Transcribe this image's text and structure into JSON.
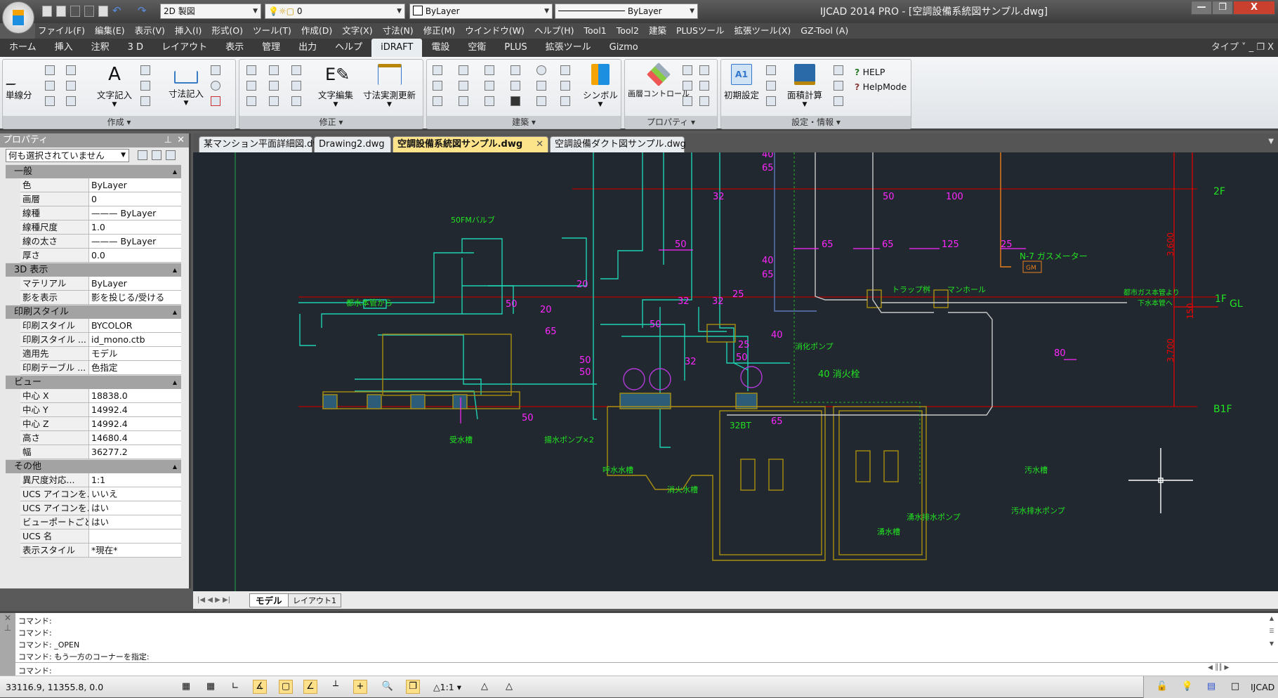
{
  "window": {
    "title": "IJCAD 2014 PRO - [空調設備系統図サンプル.dwg]",
    "minimize": "—",
    "restore": "❐",
    "close": "X"
  },
  "quick_access": {
    "workspace": "2D 製図",
    "layer": "0",
    "color": "ByLayer",
    "linetype": "ByLayer"
  },
  "menu": [
    "ファイル(F)",
    "編集(E)",
    "表示(V)",
    "挿入(I)",
    "形式(O)",
    "ツール(T)",
    "作成(D)",
    "文字(X)",
    "寸法(N)",
    "修正(M)",
    "ウインドウ(W)",
    "ヘルプ(H)",
    "Tool1",
    "Tool2",
    "建築",
    "PLUSツール",
    "拡張ツール(X)",
    "GZ-Tool (A)"
  ],
  "ribbon_tabs": [
    "ホーム",
    "挿入",
    "注釈",
    "3 D",
    "レイアウト",
    "表示",
    "管理",
    "出力",
    "ヘルプ",
    "iDRAFT",
    "電設",
    "空衛",
    "PLUS",
    "拡張ツール",
    "Gizmo"
  ],
  "ribbon_active_tab": "iDRAFT",
  "ribbon_right": "タイプ ˅  _  ❐  X",
  "ribbon_groups": {
    "create": {
      "title": "作成 ▾",
      "single_line": "単線分",
      "text": "文字記入",
      "dimension": "寸法記入"
    },
    "modify": {
      "title": "修正 ▾",
      "text_edit": "文字編集",
      "dim_update": "寸法実測更新"
    },
    "architecture": {
      "title": "建築 ▾",
      "symbol": "シンボル"
    },
    "properties": {
      "title": "プロパティ ▾",
      "layer_control": "画層コントロール"
    },
    "settings": {
      "title": "設定・情報 ▾",
      "initial": "初期設定",
      "area": "面積計算",
      "help": "HELP",
      "helpmode": "HelpMode"
    }
  },
  "properties_panel": {
    "title": "プロパティ",
    "selection": "何も選択されていません",
    "sections": [
      {
        "name": "一般",
        "rows": [
          [
            "色",
            "ByLayer"
          ],
          [
            "画層",
            "0"
          ],
          [
            "線種",
            "——— ByLayer"
          ],
          [
            "線種尺度",
            "1.0"
          ],
          [
            "線の太さ",
            "——— ByLayer"
          ],
          [
            "厚さ",
            "0.0"
          ]
        ]
      },
      {
        "name": "3D 表示",
        "rows": [
          [
            "マテリアル",
            "ByLayer"
          ],
          [
            "影を表示",
            "影を投じる/受ける"
          ]
        ]
      },
      {
        "name": "印刷スタイル",
        "rows": [
          [
            "印刷スタイル",
            "BYCOLOR"
          ],
          [
            "印刷スタイル ...",
            "id_mono.ctb"
          ],
          [
            "適用先",
            "モデル"
          ],
          [
            "印刷テーブル ...",
            "色指定"
          ]
        ]
      },
      {
        "name": "ビュー",
        "rows": [
          [
            "中心 X",
            "18838.0"
          ],
          [
            "中心 Y",
            "14992.4"
          ],
          [
            "中心 Z",
            "14992.4"
          ],
          [
            "高さ",
            "14680.4"
          ],
          [
            "幅",
            "36277.2"
          ]
        ]
      },
      {
        "name": "その他",
        "rows": [
          [
            "異尺度対応...",
            "1:1"
          ],
          [
            "UCS アイコンを...",
            "いいえ"
          ],
          [
            "UCS アイコンを...",
            "はい"
          ],
          [
            "ビューポートごと...",
            "はい"
          ],
          [
            "UCS 名",
            ""
          ],
          [
            "表示スタイル",
            "*現在*"
          ]
        ]
      }
    ]
  },
  "doc_tabs": [
    {
      "label": "某マンション平面詳細図.dwg",
      "active": false
    },
    {
      "label": "Drawing2.dwg",
      "active": false
    },
    {
      "label": "空調設備系統図サンプル.dwg",
      "active": true
    },
    {
      "label": "空調設備ダクト図サンプル.dwg",
      "active": false
    }
  ],
  "drawing": {
    "background": "#212830",
    "floors": {
      "f2": "2F",
      "f1": "1F",
      "gl": "GL",
      "b1": "B1F"
    },
    "dims": {
      "d1": "3,600",
      "d2": "3,700",
      "d3": "150"
    },
    "labels": {
      "fm_valve": "50FMバルブ",
      "city_water": "都水本管から",
      "receive_tank": "受水槽",
      "lift_pump": "揚水ポンプ×2",
      "prime_tank": "呼水水槽",
      "fire_tank": "消火水槽",
      "fire_pump": "消化ポンプ",
      "hydrant": "40 消火栓",
      "spring_pump": "湧水排水ポンプ",
      "spring_tank": "湧水槽",
      "sewage_tank": "汚水槽",
      "sewage_pump": "汚水排水ポンプ",
      "gas_meter": "N-7 ガスメーター",
      "gm": "GM",
      "trap": "トラップ桝",
      "manhole": "マンホール",
      "gas_main": "都市ガス本管より",
      "sewer": "下水本管へ",
      "bt": "32BT"
    },
    "sizes": [
      "20",
      "20",
      "50",
      "65",
      "50",
      "50",
      "50",
      "32",
      "50",
      "32",
      "32",
      "25",
      "25",
      "50",
      "32",
      "40",
      "65",
      "40",
      "65",
      "40",
      "50",
      "65",
      "50",
      "100",
      "65",
      "65",
      "125",
      "25",
      "80"
    ]
  },
  "layout_tabs": [
    "モデル",
    "レイアウト1"
  ],
  "command": {
    "lines": [
      "コマンド:",
      "コマンド:",
      "コマンド: _OPEN",
      "コマンド: もう一方のコーナーを指定:"
    ],
    "prompt": "コマンド:"
  },
  "status": {
    "coords": "33116.9, 11355.8, 0.0",
    "scale": "1:1",
    "brand": "IJCAD"
  }
}
